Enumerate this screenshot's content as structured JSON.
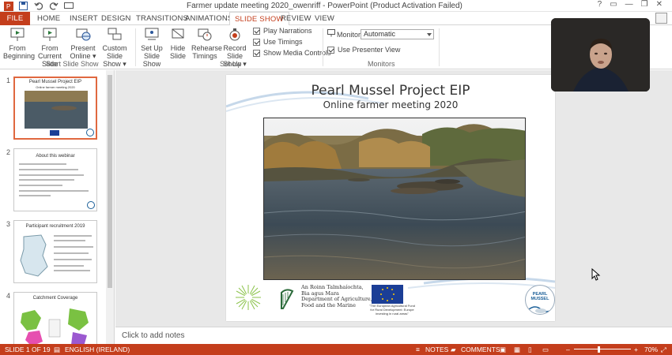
{
  "window": {
    "title": "Farmer update meeting 2020_owenriff -  PowerPoint (Product Activation Failed)"
  },
  "ribbon_tabs": [
    {
      "label": "FILE"
    },
    {
      "label": "HOME"
    },
    {
      "label": "INSERT"
    },
    {
      "label": "DESIGN"
    },
    {
      "label": "TRANSITIONS"
    },
    {
      "label": "ANIMATIONS"
    },
    {
      "label": "SLIDE SHOW"
    },
    {
      "label": "REVIEW"
    },
    {
      "label": "VIEW"
    }
  ],
  "active_tab": "SLIDE SHOW",
  "ribbon": {
    "start_group": {
      "label": "Start Slide Show",
      "buttons": [
        {
          "line1": "From",
          "line2": "Beginning"
        },
        {
          "line1": "From",
          "line2": "Current Slide"
        },
        {
          "line1": "Present",
          "line2": "Online ▾"
        },
        {
          "line1": "Custom Slide",
          "line2": "Show ▾"
        }
      ]
    },
    "setup_group": {
      "label": "Set Up",
      "buttons": [
        {
          "line1": "Set Up",
          "line2": "Slide Show"
        },
        {
          "line1": "Hide",
          "line2": "Slide"
        },
        {
          "line1": "Rehearse",
          "line2": "Timings"
        },
        {
          "line1": "Record Slide",
          "line2": "Show ▾"
        }
      ],
      "checkboxes": [
        {
          "label": "Play Narrations",
          "checked": true
        },
        {
          "label": "Use Timings",
          "checked": true
        },
        {
          "label": "Show Media Controls",
          "checked": true
        }
      ]
    },
    "monitors_group": {
      "label": "Monitors",
      "monitor_label": "Monitor",
      "monitor_value": "Automatic",
      "presenter_view": {
        "label": "Use Presenter View",
        "checked": true
      }
    }
  },
  "thumbnails": [
    {
      "number": "1",
      "title": "Pearl Mussel Project EIP",
      "subtitle": "Online farmer meeting 2020",
      "selected": true
    },
    {
      "number": "2",
      "title": "About this webinar",
      "selected": false
    },
    {
      "number": "3",
      "title": "Participant recruitment 2019",
      "selected": false
    },
    {
      "number": "4",
      "title": "Catchment Coverage",
      "selected": false
    }
  ],
  "slide": {
    "title": "Pearl Mussel Project EIP",
    "subtitle": "Online farmer meeting 2020",
    "logos": {
      "agri_line1": "An Roinn Talmhaíochta,",
      "agri_line2": "Bia agus Mara",
      "agri_line3": "Department of Agriculture,",
      "agri_line4": "Food and the Marine",
      "eu_line1": "\"The European Agricultural Fund",
      "eu_line2": "for Rural Development: Europe",
      "eu_line3": "investing in rural areas\"",
      "badge_line1": "PEARL",
      "badge_line2": "MUSSEL"
    }
  },
  "notes_placeholder": "Click to add notes",
  "status": {
    "slide_info": "SLIDE 1 OF 19",
    "language": "ENGLISH (IRELAND)",
    "notes_label": "NOTES",
    "comments_label": "COMMENTS",
    "zoom": "70%"
  },
  "colors": {
    "accent": "#c43e1c",
    "selection": "#e0683f"
  }
}
